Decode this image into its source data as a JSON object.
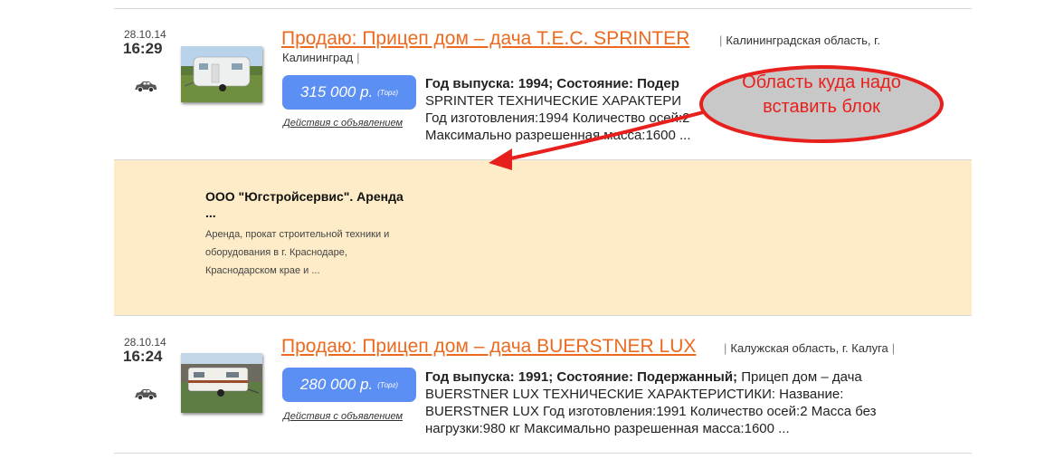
{
  "listings": [
    {
      "date": "28.10.14",
      "time": "16:29",
      "title": "Продаю: Прицеп дом – дача T.E.C. SPRINTER",
      "region_line1": "Калининградская область, г.",
      "region_line2": "Калининград",
      "price": "315 000 р.",
      "price_note": "(Торг)",
      "actions_link": "Действия с объявлением",
      "desc_bold": "Год выпуска: 1994; Состояние: Подер",
      "desc_line2": "SPRINTER ТЕХНИЧЕСКИЕ ХАРАКТЕРИ",
      "desc_line3": "Год изготовления:1994 Количество осей:2",
      "desc_line4": "Максимально разрешенная масса:1600 ..."
    },
    {
      "date": "28.10.14",
      "time": "16:24",
      "title": "Продаю: Прицеп дом – дача BUERSTNER LUX",
      "region_line1": "Калужская область, г. Калуга",
      "price": "280 000 р.",
      "price_note": "(Торг)",
      "actions_link": "Действия с объявлением",
      "desc_bold": "Год выпуска: 1991; Состояние: Подержанный;",
      "desc_rest": " Прицеп дом – дача",
      "desc_line2": "BUERSTNER LUX ТЕХНИЧЕСКИЕ ХАРАКТЕРИСТИКИ: Название:",
      "desc_line3": "BUERSTNER LUX Год изготовления:1991 Количество осей:2 Масса без",
      "desc_line4": "нагрузки:980 кг Максимально разрешенная масса:1600 ..."
    }
  ],
  "ad": {
    "title": "ООО \"Югстройсервис\". Аренда ...",
    "text": "Аренда, прокат строительной техники и оборудования в г. Краснодаре, Краснодарском крае и ..."
  },
  "annotation": {
    "line1": "Область куда надо",
    "line2": "вставить блок"
  },
  "icons": {
    "vehicle": "car-icon",
    "photo": "trailer-photo"
  },
  "colors": {
    "title_link": "#ec6a1f",
    "price_badge": "#5b8ff4",
    "ad_background": "#fdecc7",
    "annotation_red": "#e8201d",
    "callout_fill": "#c8c8c8"
  }
}
